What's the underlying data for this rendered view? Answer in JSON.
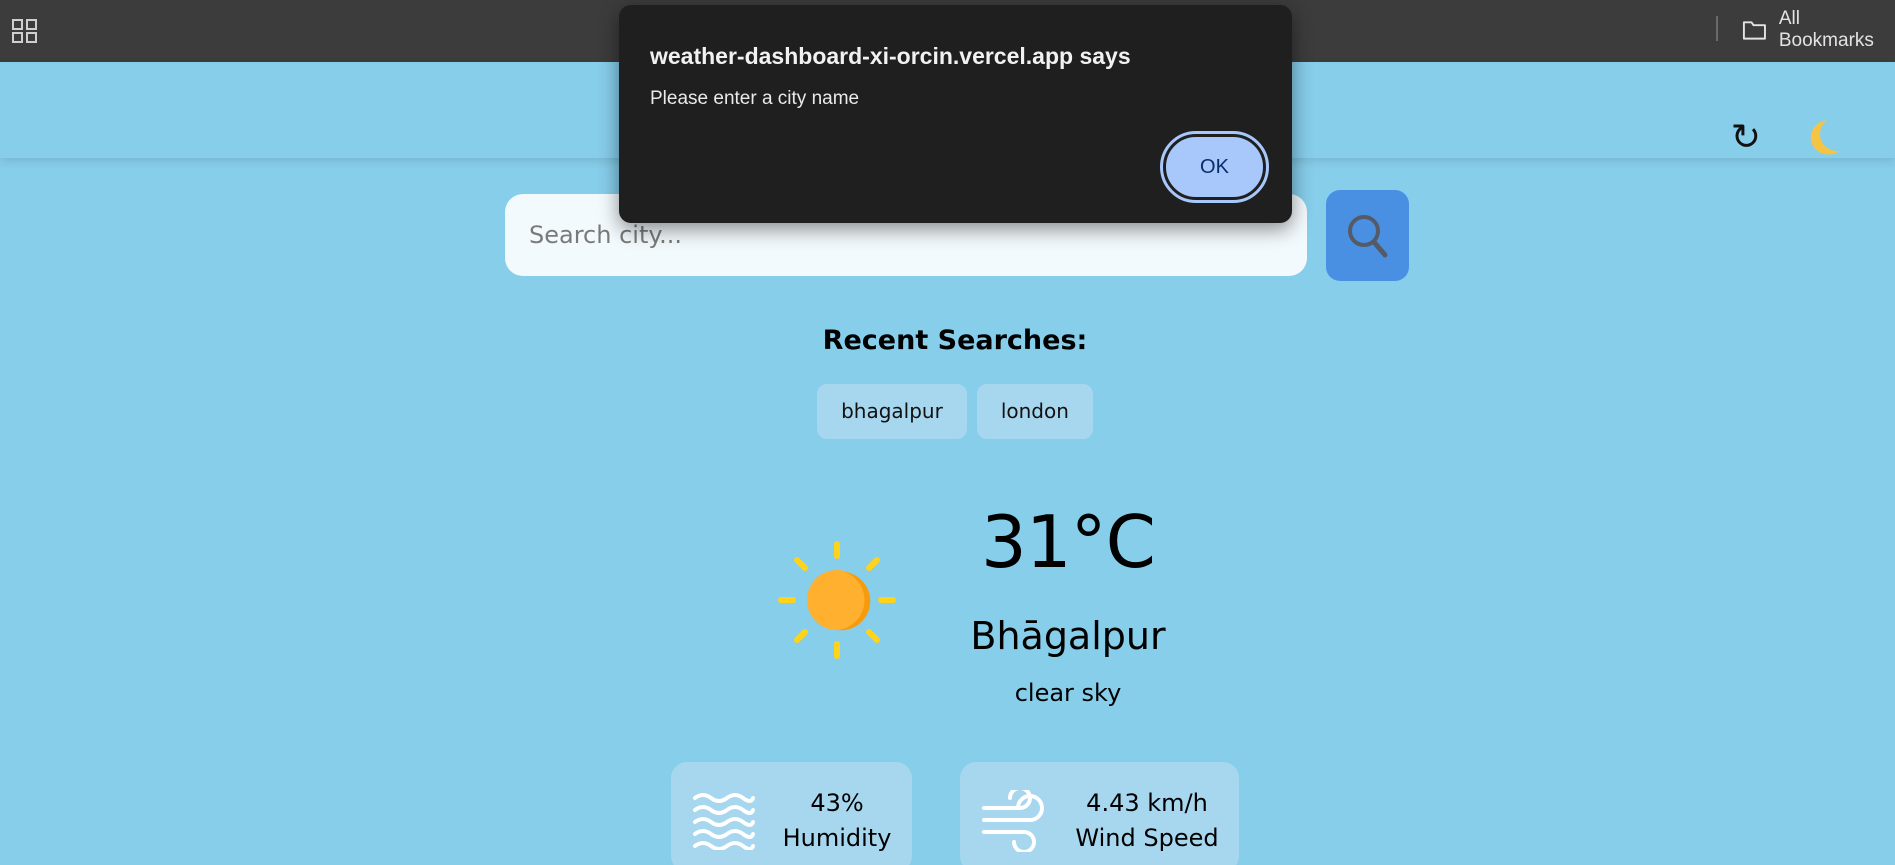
{
  "browser": {
    "apps_icon": "apps-grid-icon",
    "bookmarks_label": "All Bookmarks",
    "bookmarks_icon": "folder-icon"
  },
  "header": {
    "refresh_icon": "↻",
    "theme_icon": "moon-icon"
  },
  "search": {
    "placeholder": "Search city...",
    "value": "",
    "button_icon": "search-icon"
  },
  "recent": {
    "title": "Recent Searches:",
    "items": [
      "bhagalpur",
      "london"
    ]
  },
  "weather": {
    "icon": "sun-icon",
    "temperature": "31°C",
    "city": "Bhāgalpur",
    "description": "clear sky"
  },
  "details": {
    "humidity": {
      "value": "43%",
      "label": "Humidity",
      "icon": "humidity-waves-icon"
    },
    "wind": {
      "value": "4.43 km/h",
      "label": "Wind Speed",
      "icon": "wind-icon"
    }
  },
  "dialog": {
    "title": "weather-dashboard-xi-orcin.vercel.app says",
    "message": "Please enter a city name",
    "ok_label": "OK"
  },
  "colors": {
    "background": "#87ceeb",
    "search_button": "#4a90e2",
    "dialog_background": "#1f1f1f",
    "ok_button": "#a8c7fa",
    "sun": "#ffb02e",
    "sun_rays": "#ffd31a"
  }
}
